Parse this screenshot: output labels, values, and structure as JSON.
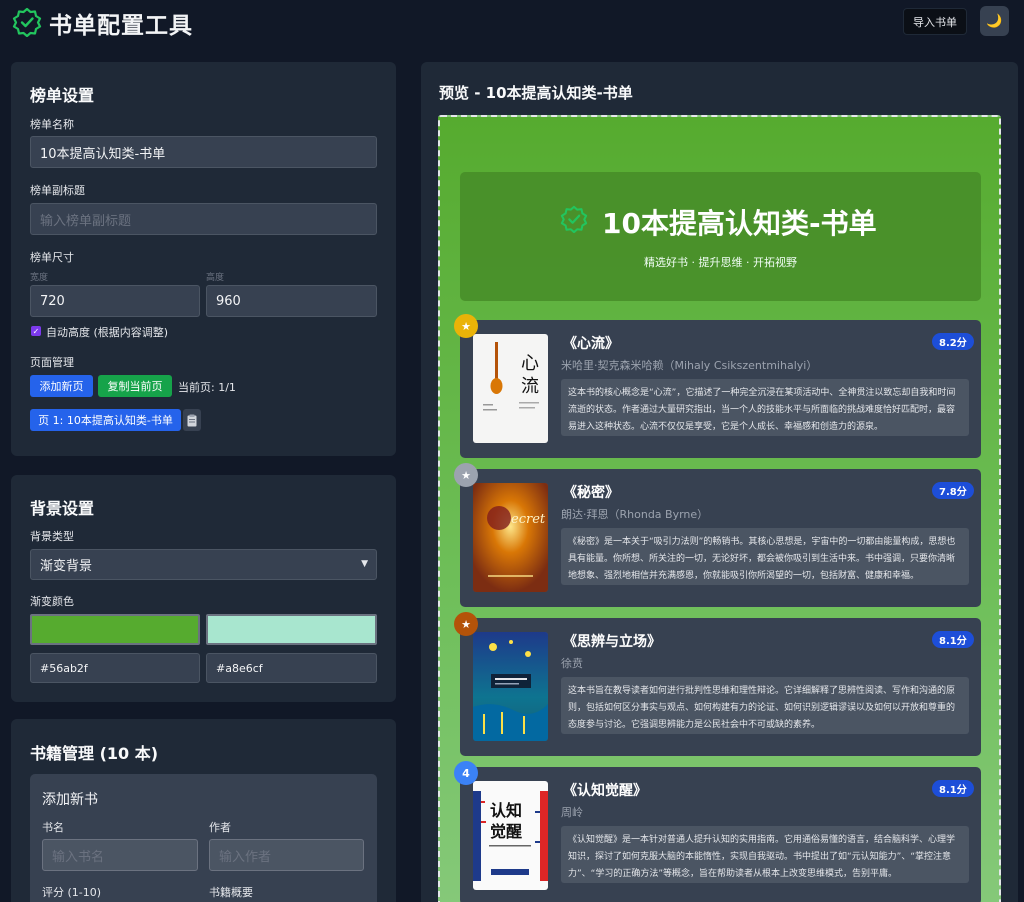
{
  "app": {
    "title": "书单配置工具",
    "import_label": "导入书单",
    "theme_icon": "moon-icon"
  },
  "list_settings": {
    "title": "榜单设置",
    "name_label": "榜单名称",
    "name_value": "10本提高认知类-书单",
    "subtitle_label": "榜单副标题",
    "subtitle_placeholder": "输入榜单副标题",
    "size_label": "榜单尺寸",
    "width_label": "宽度",
    "width_value": "720",
    "height_label": "高度",
    "height_value": "960",
    "auto_height_label": "自动高度 (根据内容调整)",
    "auto_height_checked": true,
    "page_mgmt_label": "页面管理",
    "add_page_label": "添加新页",
    "copy_page_label": "复制当前页",
    "current_page": "当前页: 1/1",
    "page_chip": "页 1: 10本提高认知类-书单"
  },
  "bg_settings": {
    "title": "背景设置",
    "type_label": "背景类型",
    "type_value": "渐变背景",
    "gradient_label": "渐变颜色",
    "color1": "#56ab2f",
    "color2": "#a8e6cf"
  },
  "book_mgmt": {
    "title": "书籍管理 (10 本)",
    "add_title": "添加新书",
    "name_label": "书名",
    "name_placeholder": "输入书名",
    "author_label": "作者",
    "author_placeholder": "输入作者",
    "score_label": "评分 (1-10)",
    "summary_label": "书籍概要"
  },
  "preview": {
    "title": "预览 - 10本提高认知类-书单",
    "hero_title": "10本提高认知类-书单",
    "hero_subtitle": "精选好书 · 提升思维 · 开拓视野",
    "books": [
      {
        "rank": "1",
        "badge_color": "#eab308",
        "title": "《心流》",
        "author": "米哈里·契克森米哈赖（Mihaly Csikszentmihalyi）",
        "score": "8.2分",
        "summary": "这本书的核心概念是“心流”，它描述了一种完全沉浸在某项活动中、全神贯注以致忘却自我和时间流逝的状态。作者通过大量研究指出，当一个人的技能水平与所面临的挑战难度恰好匹配时，最容易进入这种状态。心流不仅仅是享受，它是个人成长、幸福感和创造力的源泉。",
        "cover_text": "心流"
      },
      {
        "rank": "2",
        "badge_color": "#9ca3af",
        "title": "《秘密》",
        "author": "朗达·拜恩（Rhonda Byrne）",
        "score": "7.8分",
        "summary": "《秘密》是一本关于“吸引力法则”的畅销书。其核心思想是，宇宙中的一切都由能量构成，思想也具有能量。你所想、所关注的一切，无论好坏，都会被你吸引到生活中来。书中强调，只要你清晰地想象、强烈地相信并充满感恩，你就能吸引你所渴望的一切，包括财富、健康和幸福。",
        "cover_text": "Secret"
      },
      {
        "rank": "3",
        "badge_color": "#b45309",
        "title": "《思辨与立场》",
        "author": "徐贲",
        "score": "8.1分",
        "summary": "这本书旨在教导读者如何进行批判性思维和理性辩论。它详细解释了思辨性阅读、写作和沟通的原则，包括如何区分事实与观点、如何构建有力的论证、如何识别逻辑谬误以及如何以开放和尊重的态度参与讨论。它强调思辨能力是公民社会中不可或缺的素养。",
        "cover_text": "思辨与立场"
      },
      {
        "rank": "4",
        "badge_color": "#3b82f6",
        "title": "《认知觉醒》",
        "author": "周岭",
        "score": "8.1分",
        "summary": "《认知觉醒》是一本针对普通人提升认知的实用指南。它用通俗易懂的语言，结合脑科学、心理学知识，探讨了如何克服大脑的本能惰性，实现自我驱动。书中提出了如“元认知能力”、“掌控注意力”、“学习的正确方法”等概念，旨在帮助读者从根本上改变思维模式，告别平庸。",
        "cover_text": "认知觉醒"
      }
    ]
  }
}
